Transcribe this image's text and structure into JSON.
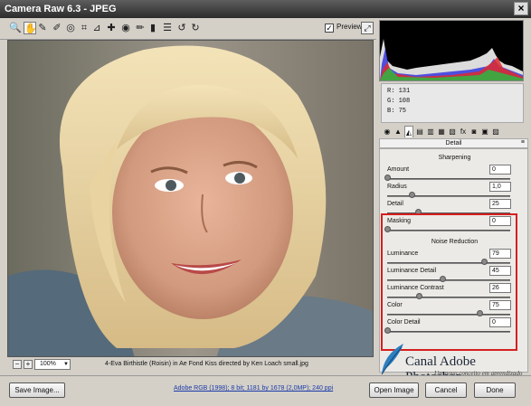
{
  "window": {
    "title": "Camera Raw 6.3  -  JPEG",
    "close_glyph": "×"
  },
  "toolbar": {
    "tools": [
      {
        "name": "zoom-tool-icon",
        "glyph": "🔍"
      },
      {
        "name": "hand-tool-icon",
        "glyph": "✋"
      },
      {
        "name": "white-balance-tool-icon",
        "glyph": "✎"
      },
      {
        "name": "color-sampler-tool-icon",
        "glyph": "✐"
      },
      {
        "name": "targeted-adjustment-tool-icon",
        "glyph": "◎"
      },
      {
        "name": "crop-tool-icon",
        "glyph": "⌗"
      },
      {
        "name": "straighten-tool-icon",
        "glyph": "⊿"
      },
      {
        "name": "spot-removal-tool-icon",
        "glyph": "✚"
      },
      {
        "name": "red-eye-tool-icon",
        "glyph": "◉"
      },
      {
        "name": "adjustment-brush-icon",
        "glyph": "✏"
      },
      {
        "name": "graduated-filter-icon",
        "glyph": "▮"
      },
      {
        "name": "preferences-icon",
        "glyph": "☰"
      },
      {
        "name": "rotate-left-icon",
        "glyph": "↺"
      },
      {
        "name": "rotate-right-icon",
        "glyph": "↻"
      }
    ],
    "preview_label": "Preview",
    "preview_checked": "✓"
  },
  "rgb_readout": {
    "r": "R:   131",
    "g": "G:   108",
    "b": "B:    75"
  },
  "panel": {
    "title": "Detail",
    "tabs": [
      "◉",
      "▲",
      "◭",
      "▤",
      "▥",
      "▦",
      "▧",
      "fx",
      "◙",
      "▣",
      "▨"
    ],
    "sharpening": {
      "heading": "Sharpening",
      "sliders": [
        {
          "label": "Amount",
          "value": "0",
          "fraction": 0.0
        },
        {
          "label": "Radius",
          "value": "1,0",
          "fraction": 0.2
        },
        {
          "label": "Detail",
          "value": "25",
          "fraction": 0.25
        },
        {
          "label": "Masking",
          "value": "0",
          "fraction": 0.0
        }
      ]
    },
    "noise_reduction": {
      "heading": "Noise Reduction",
      "sliders": [
        {
          "label": "Luminance",
          "value": "79",
          "fraction": 0.79
        },
        {
          "label": "Luminance Detail",
          "value": "45",
          "fraction": 0.45
        },
        {
          "label": "Luminance Contrast",
          "value": "26",
          "fraction": 0.26
        },
        {
          "label": "Color",
          "value": "75",
          "fraction": 0.75
        },
        {
          "label": "Color Detail",
          "value": "0",
          "fraction": 0.0
        }
      ]
    }
  },
  "status": {
    "zoom_minus": "−",
    "zoom_plus": "+",
    "zoom_value": "100%",
    "filename": "4-Eva Birthistle (Roisin) in Ae Fond Kiss directed by Ken Loach small.jpg"
  },
  "bottom": {
    "save_label": "Save Image...",
    "workflow_link": "Adobe RGB (1998); 8 bit; 1181 by 1678 (2,0MP); 240 ppi",
    "open_label": "Open Image",
    "cancel_label": "Cancel",
    "done_label": "Done"
  },
  "watermark": {
    "title": "Canal Adobe Photoshop",
    "subtitle": "Um novo conceito em aprendizado"
  },
  "colors": {
    "accent_red": "#d42020",
    "link_blue": "#1a3aa8"
  }
}
